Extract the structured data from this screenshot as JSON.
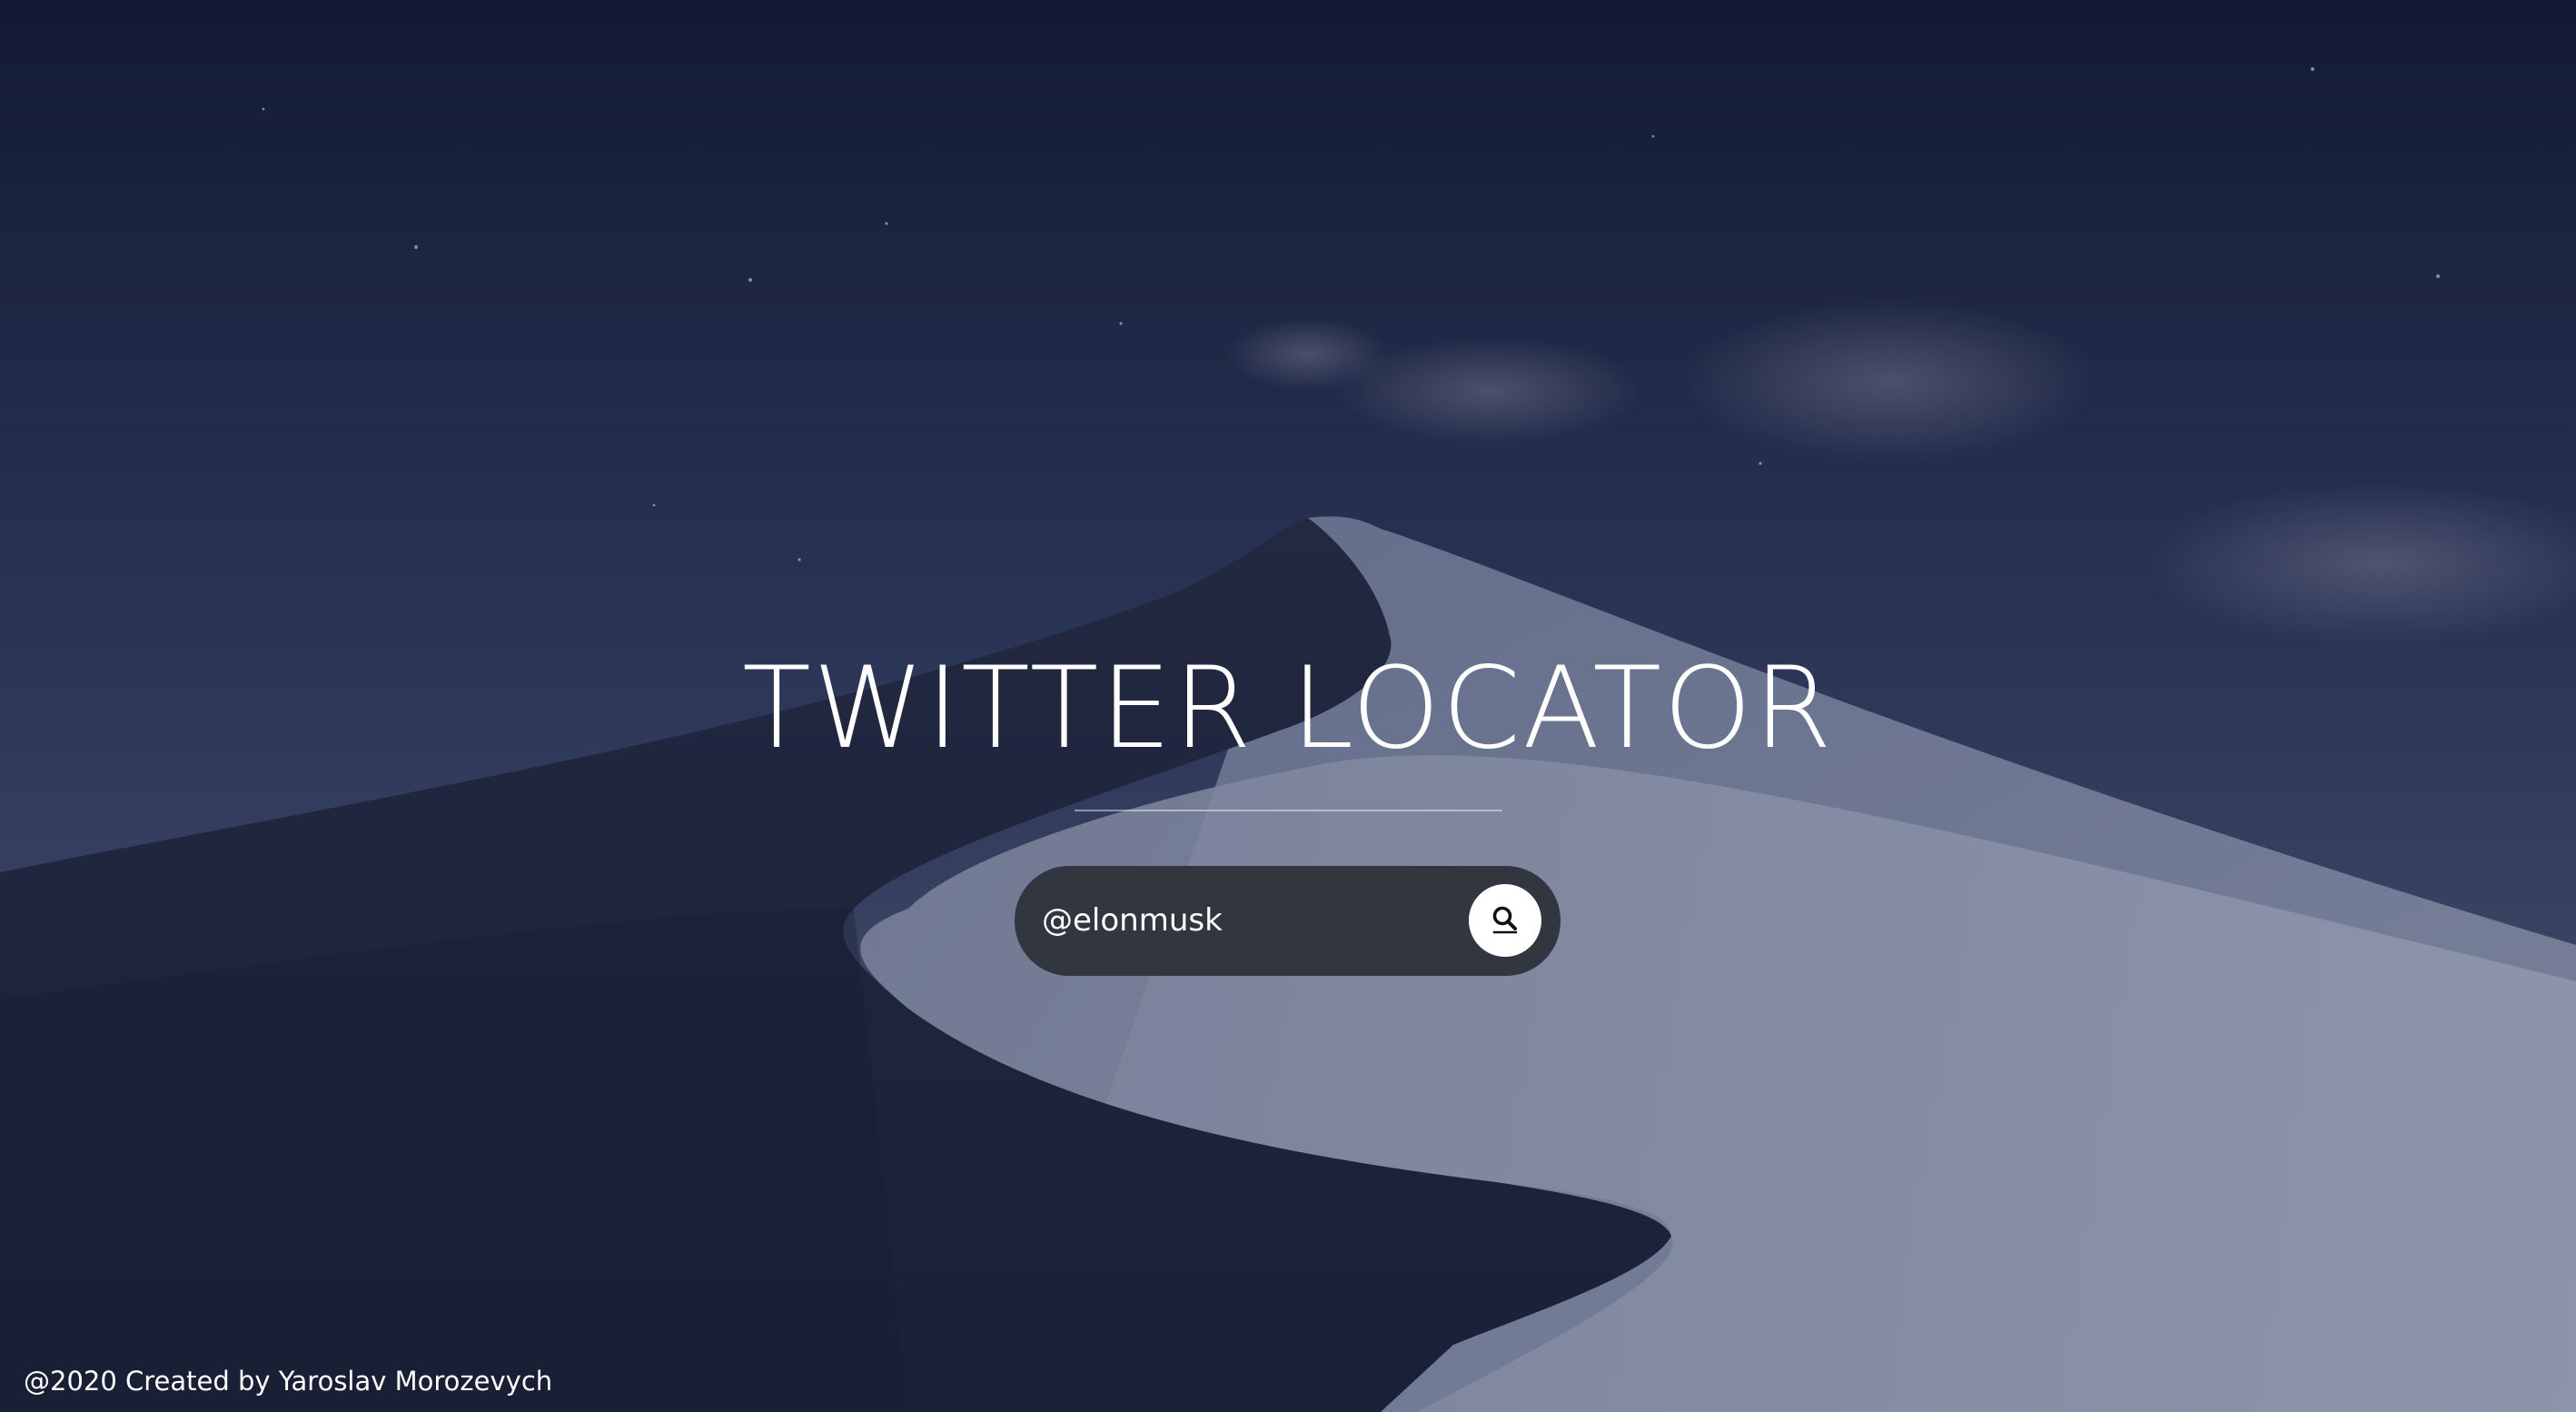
{
  "header": {
    "title": "TWITTER LOCATOR"
  },
  "search": {
    "value": "@elonmusk",
    "placeholder": "@elonmusk",
    "button_icon": "search-icon"
  },
  "footer": {
    "text": "@2020 Created by Yaroslav Morozevych"
  },
  "colors": {
    "sky_top": "#141d36",
    "sky_bottom": "#4c5878",
    "search_bg": "#31363f",
    "button_bg": "#ffffff",
    "text": "#ffffff"
  }
}
